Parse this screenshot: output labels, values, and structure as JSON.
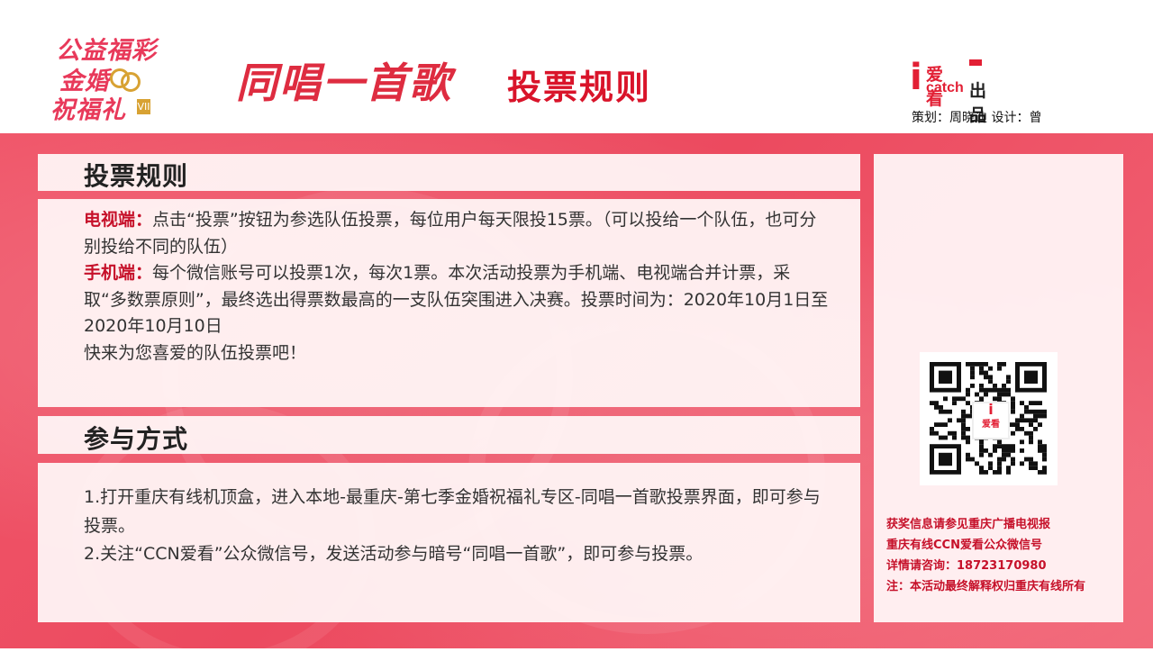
{
  "header": {
    "logo_lines": [
      "公益福彩",
      "金婚",
      "祝福礼"
    ],
    "logo_badge": "VII",
    "title_script": "同唱一首歌",
    "title_main": "投票规则",
    "brand_i": "i",
    "brand_name": "爱看",
    "brand_catch": "catch",
    "brand_suffix": "出品",
    "credit": "策划：周晓迪  设计：曾"
  },
  "rules": {
    "heading": "投票规则",
    "tv_label": "电视端：",
    "tv_text": "点击“投票”按钮为参选队伍投票，每位用户每天限投15票。（可以投给一个队伍，也可分别投给不同的队伍）",
    "mobile_label": "手机端：",
    "mobile_text": "每个微信账号可以投票1次，每次1票。本次活动投票为手机端、电视端合并计票，采取“多数票原则”，最终选出得票数最高的一支队伍突围进入决赛。投票时间为：2020年10月1日至2020年10月10日",
    "closing": "快来为您喜爱的队伍投票吧！"
  },
  "participation": {
    "heading": "参与方式",
    "step1": "1.打开重庆有线机顶盒，进入本地-最重庆-第七季金婚祝福礼专区-同唱一首歌投票界面，即可参与投票。",
    "step2": "2.关注“CCN爱看”公众微信号，发送活动参与暗号“同唱一首歌”，即可参与投票。"
  },
  "sidebar": {
    "qr_label": "爱看",
    "info": [
      "获奖信息请参见重庆广播电视报",
      "重庆有线CCN爱看公众微信号",
      "详情请咨询：18723170980",
      "注：本活动最终解释权归重庆有线所有"
    ]
  },
  "colors": {
    "accent": "#e21f34",
    "background": "#ec4a5f",
    "panel": "#fff6f7"
  }
}
